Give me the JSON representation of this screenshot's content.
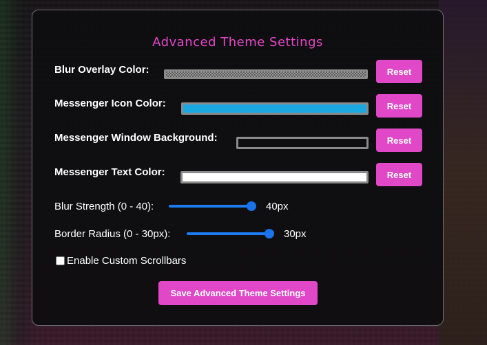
{
  "panel": {
    "title": "Advanced Theme Settings"
  },
  "colors": {
    "accent": "#e048c8",
    "slider": "#1a73e8"
  },
  "color_settings": [
    {
      "label": "Blur Overlay Color:",
      "reset_label": "Reset",
      "swatch": "checkered-gray"
    },
    {
      "label": "Messenger Icon Color:",
      "reset_label": "Reset",
      "swatch": "#1ba8e0"
    },
    {
      "label": "Messenger Window Background:",
      "reset_label": "Reset",
      "swatch": "transparent"
    },
    {
      "label": "Messenger Text Color:",
      "reset_label": "Reset",
      "swatch": "#ffffff"
    }
  ],
  "sliders": [
    {
      "label": "Blur Strength (0 - 40):",
      "value_text": "40px",
      "fraction": 1.0
    },
    {
      "label": "Border Radius (0 - 30px):",
      "value_text": "30px",
      "fraction": 1.0
    }
  ],
  "checkbox": {
    "label": "Enable Custom Scrollbars",
    "checked": false
  },
  "save_label": "Save Advanced Theme Settings"
}
